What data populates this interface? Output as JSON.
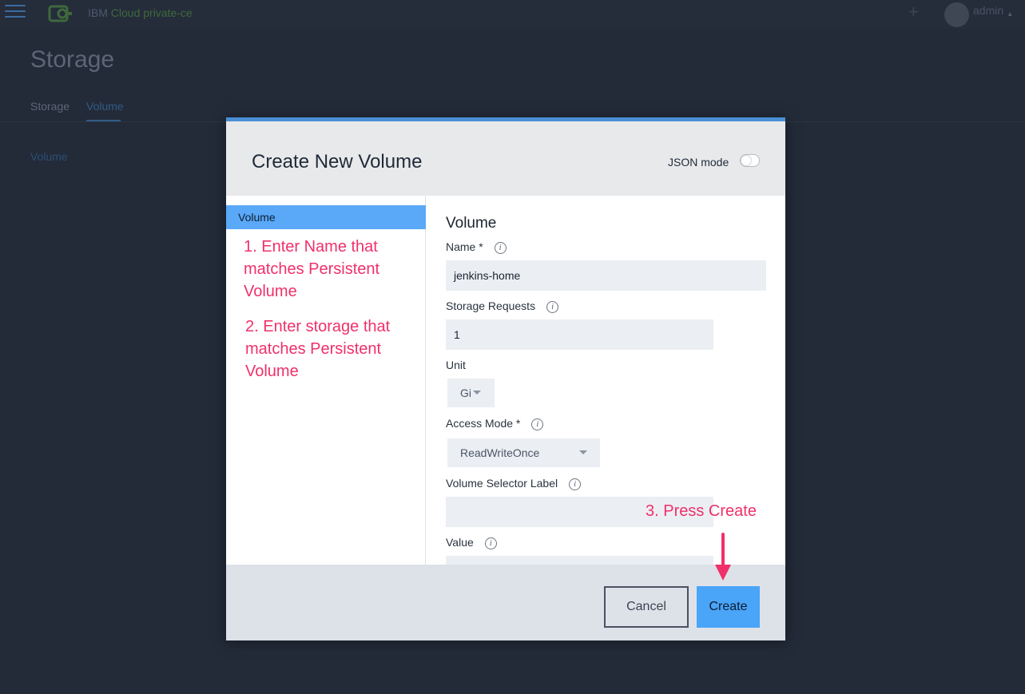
{
  "topbar": {
    "brand_prefix": "IBM ",
    "brand_product": "Cloud private-ce",
    "plus_icon": "+",
    "user_name": "admin",
    "user_caret": "▴"
  },
  "page": {
    "title": "Storage",
    "tabs": [
      {
        "label": "Storage",
        "active": false
      },
      {
        "label": "Volume",
        "active": true
      }
    ],
    "background_link": "Volume"
  },
  "modal": {
    "title": "Create New Volume",
    "json_mode_label": "JSON mode",
    "json_mode_on": false,
    "sidebar": {
      "items": [
        {
          "label": "Volume",
          "selected": true
        }
      ]
    },
    "annotations": {
      "step1": "1. Enter Name that matches Persistent Volume",
      "step2": "2. Enter storage that matches Persistent Volume",
      "step3": "3. Press Create"
    },
    "form": {
      "heading": "Volume",
      "name": {
        "label": "Name *",
        "value": "jenkins-home"
      },
      "storage_requests": {
        "label": "Storage Requests",
        "value": "1"
      },
      "unit": {
        "label": "Unit",
        "selected": "Gi"
      },
      "access_mode": {
        "label": "Access Mode *",
        "selected": "ReadWriteOnce"
      },
      "volume_selector_label": {
        "label": "Volume Selector Label",
        "value": ""
      },
      "value": {
        "label": "Value",
        "value": ""
      },
      "info_icon_glyph": "i"
    },
    "footer": {
      "cancel_label": "Cancel",
      "create_label": "Create"
    }
  },
  "colors": {
    "accent": "#4aa4f8",
    "annotation": "#f0306a",
    "background": "#232b39"
  }
}
